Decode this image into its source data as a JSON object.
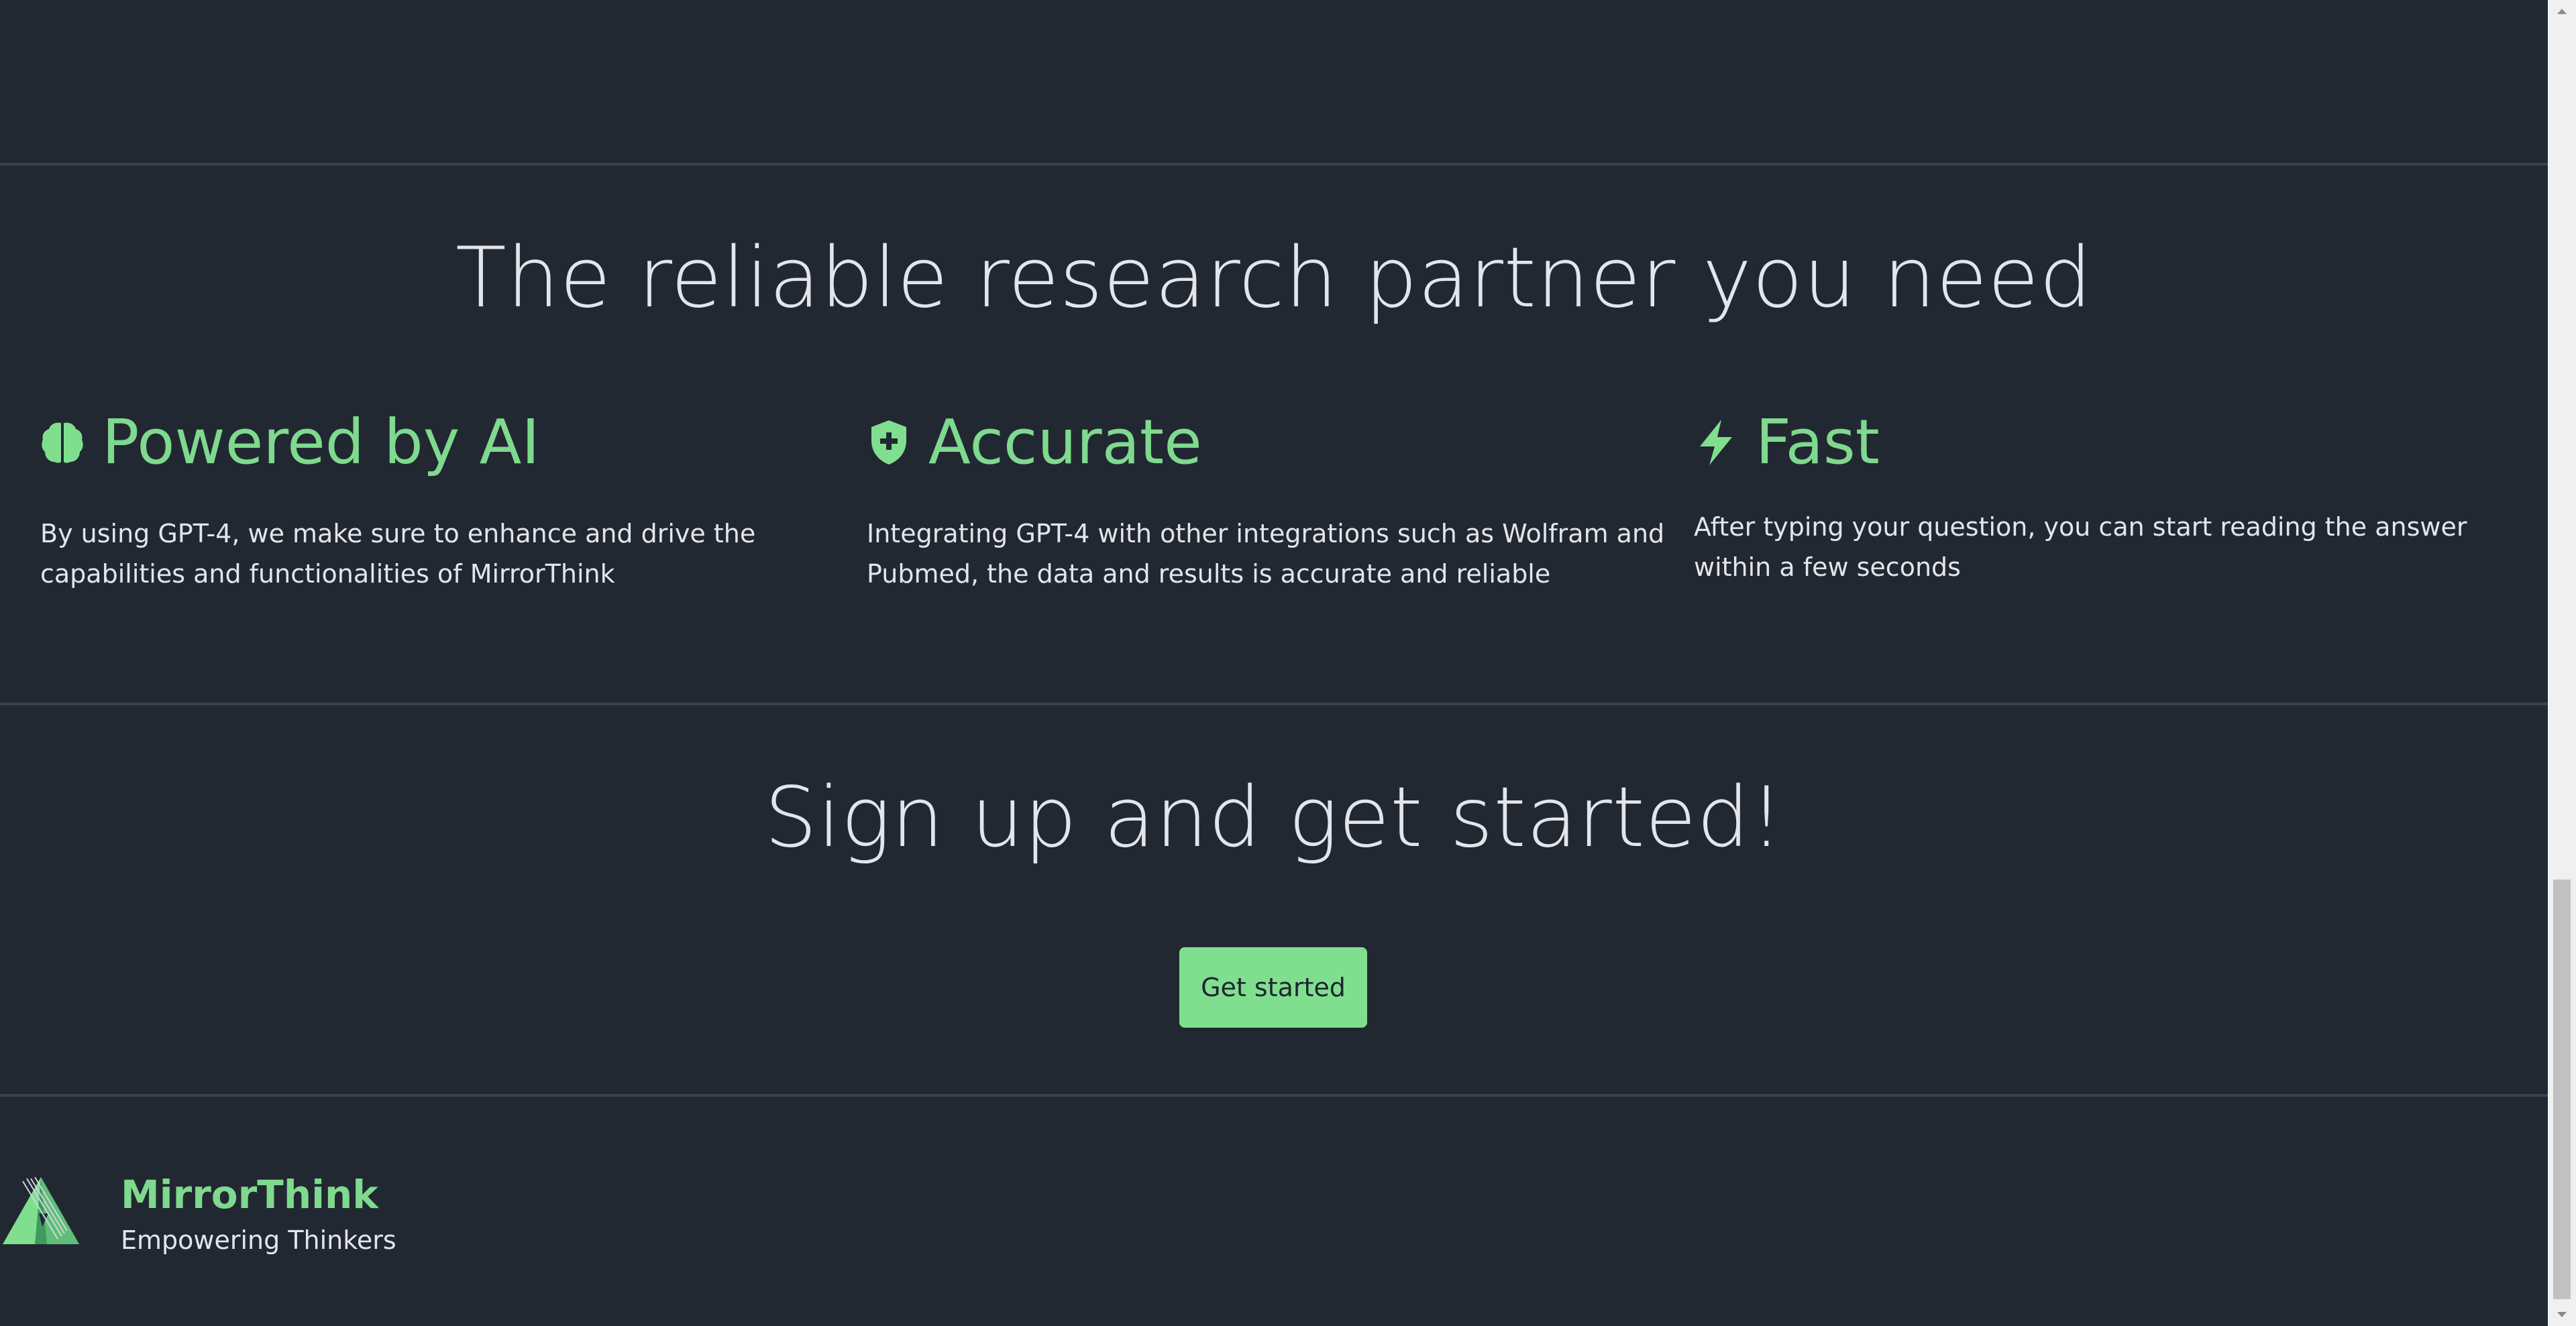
{
  "features_section": {
    "title": "The reliable research partner you need",
    "items": [
      {
        "icon": "brain-icon",
        "title": "Powered by AI",
        "text": "By using GPT-4, we make sure to enhance and drive the capabilities and functionalities of MirrorThink"
      },
      {
        "icon": "shield-plus-icon",
        "title": "Accurate",
        "text": "Integrating GPT-4 with other integrations such as Wolfram and Pubmed, the data and results is accurate and reliable"
      },
      {
        "icon": "lightning-icon",
        "title": "Fast",
        "text": "After typing your question, you can start reading the answer within a few seconds"
      }
    ]
  },
  "signup_section": {
    "title": "Sign up and get started!",
    "button_label": "Get started"
  },
  "footer": {
    "logo_icon": "mirrorthink-logo-icon",
    "brand": "MirrorThink",
    "tagline": "Empowering Thinkers"
  },
  "colors": {
    "background": "#222832",
    "accent": "#80df8e",
    "text": "#e3e5ea",
    "divider": "#3a414c"
  }
}
